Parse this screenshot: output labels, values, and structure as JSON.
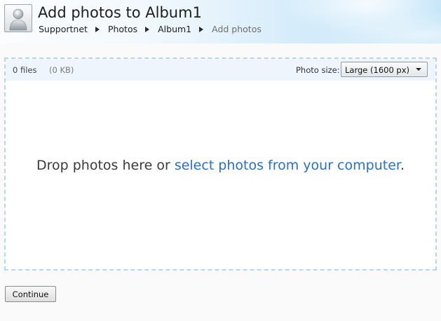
{
  "header": {
    "title": "Add photos to Album1",
    "avatar_icon": "person-icon",
    "breadcrumb": [
      {
        "label": "Supportnet"
      },
      {
        "label": "Photos"
      },
      {
        "label": "Album1"
      },
      {
        "label": "Add photos"
      }
    ]
  },
  "upload": {
    "file_count": "0 files",
    "file_size": "(0 KB)",
    "photo_size_label": "Photo size:",
    "photo_size_value": "Large (1600 px)",
    "drop_text_prefix": "Drop photos here or ",
    "select_link": "select photos from your computer",
    "drop_text_suffix": "."
  },
  "actions": {
    "continue_label": "Continue"
  },
  "colors": {
    "link": "#2a6fc0",
    "dropzone_border": "#b6d6ef",
    "info_bar": "#eef5fc"
  }
}
